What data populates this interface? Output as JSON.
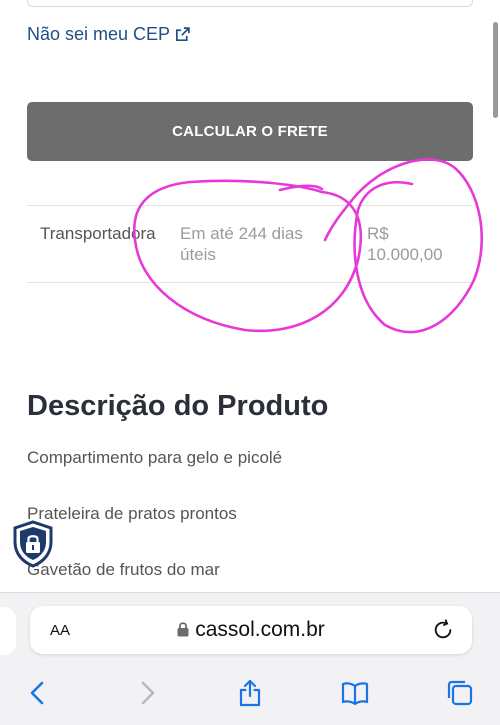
{
  "cep": {
    "link_label": "Não sei meu CEP",
    "link_icon": "external-link-icon"
  },
  "shipping": {
    "calculate_label": "CALCULAR O FRETE",
    "rows": [
      {
        "carrier": "Transportadora",
        "delivery": "Em até 244 dias úteis",
        "price": "R$ 10.000,00"
      }
    ]
  },
  "description": {
    "title": "Descrição do Produto",
    "items": [
      "Compartimento para gelo e picolé",
      "Prateleira de pratos prontos",
      "Gavetão de frutos do mar"
    ]
  },
  "security_badge": {
    "icon": "shield-lock-icon"
  },
  "annotation": {
    "color": "#e838d8"
  },
  "browser": {
    "text_size_label": "AA",
    "url": "cassol.com.br",
    "accent": "#1a73e8",
    "toolbar": [
      "back-icon",
      "forward-icon",
      "share-icon",
      "bookmarks-icon",
      "tabs-icon"
    ]
  }
}
